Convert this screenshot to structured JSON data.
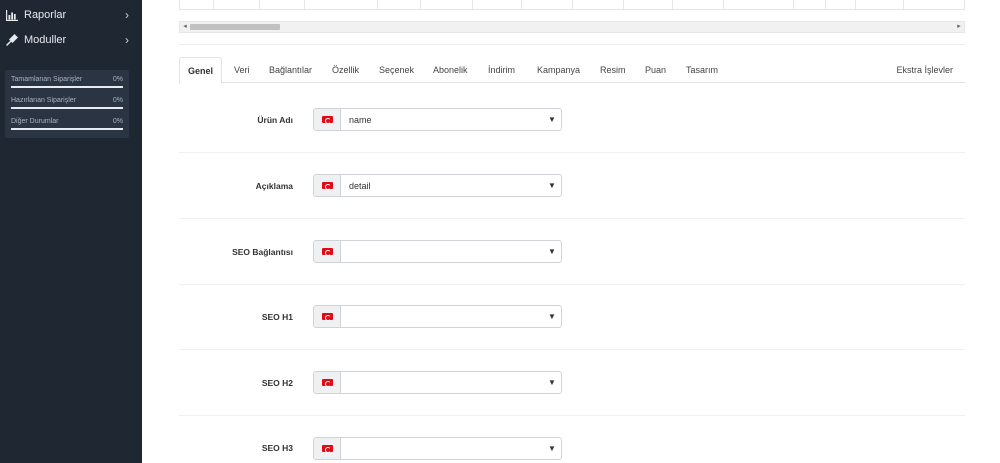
{
  "sidebar": {
    "menu": [
      {
        "label": "Raporlar",
        "icon": "bar-chart-icon"
      },
      {
        "label": "Moduller",
        "icon": "plug-icon"
      }
    ],
    "stats": [
      {
        "label": "Tamamlanan Siparişler",
        "value": "0%",
        "progress": 0
      },
      {
        "label": "Hazırlanan Siparişler",
        "value": "0%",
        "progress": 0
      },
      {
        "label": "Diğer Durumlar",
        "value": "0%",
        "progress": 0
      }
    ]
  },
  "tabs": {
    "items": [
      "Genel",
      "Veri",
      "Bağlantılar",
      "Özellik",
      "Seçenek",
      "Abonelik",
      "İndirim",
      "Kampanya",
      "Resim",
      "Puan",
      "Tasarım"
    ],
    "active": "Genel",
    "extra": "Ekstra İşlevler"
  },
  "form": {
    "rows": [
      {
        "label": "Ürün Adı",
        "value": "name"
      },
      {
        "label": "Açıklama",
        "value": "detail"
      },
      {
        "label": "SEO Bağlantısı",
        "value": ""
      },
      {
        "label": "SEO H1",
        "value": ""
      },
      {
        "label": "SEO H2",
        "value": ""
      },
      {
        "label": "SEO H3",
        "value": ""
      }
    ],
    "language_flag": "tr-flag-icon",
    "flag_color": "#e30a17"
  },
  "colors": {
    "sidebar_bg": "#1f2733",
    "stats_bg": "#2a3442",
    "accent": "#4aa3df"
  }
}
